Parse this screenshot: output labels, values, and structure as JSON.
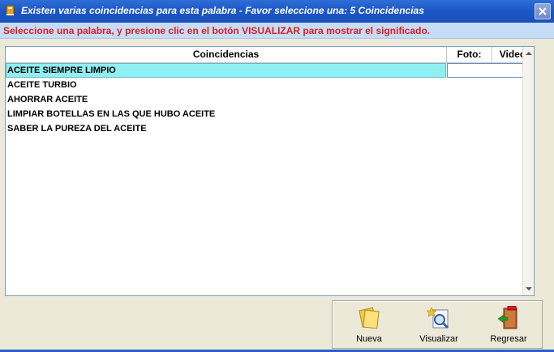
{
  "window": {
    "title": "Existen varias coincidencias para esta palabra - Favor seleccione una: 5 Coincidencias"
  },
  "instruction": "Seleccione una palabra, y presione clic en el botón VISUALIZAR para mostrar el significado.",
  "table": {
    "headers": [
      "Coincidencias",
      "Foto:",
      "Video"
    ],
    "rows": [
      "ACEITE SIEMPRE LIMPIO",
      "ACEITE TURBIO",
      "AHORRAR ACEITE",
      "LIMPIAR BOTELLAS EN LAS QUE HUBO ACEITE",
      "SABER LA PUREZA DEL ACEITE"
    ],
    "selected_index": 0
  },
  "buttons": {
    "nueva": "Nueva",
    "visualizar": "Visualizar",
    "regresar": "Regresar"
  },
  "colors": {
    "titlebar": "#1c58c8",
    "instruction_text": "#d81e1e",
    "selection": "#8ff0f4"
  },
  "icons": {
    "app": "book-icon",
    "close": "close-icon",
    "nueva": "new-documents-icon",
    "visualizar": "magnifier-document-icon",
    "regresar": "exit-door-icon"
  }
}
